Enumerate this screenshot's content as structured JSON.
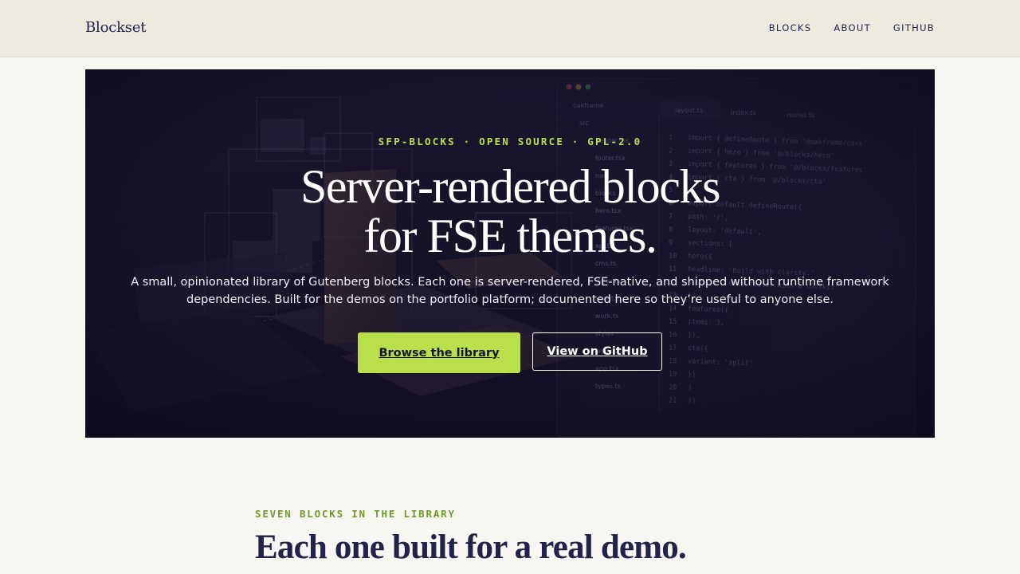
{
  "header": {
    "logo": "Blockset",
    "nav": [
      {
        "label": "BLOCKS"
      },
      {
        "label": "ABOUT"
      },
      {
        "label": "GITHUB"
      }
    ]
  },
  "hero": {
    "eyebrow": "SFP-BLOCKS · OPEN SOURCE · GPL-2.0",
    "title_line1": "Server-rendered blocks",
    "title_line2": "for FSE themes.",
    "description": "A small, opinionated library of Gutenberg blocks. Each one is server-rendered, FSE-native, and shipped without runtime framework dependencies. Built for the demos on the portfolio platform; documented here so they’re useful to anyone else.",
    "primary_button": "Browse the library",
    "secondary_button": "View on GitHub",
    "editor": {
      "tree": [
        "oakframe",
        "src",
        "header.tsx",
        "footer.tsx",
        "nav",
        "blocks",
        "hero.tsx",
        "features.tsx",
        "api.ts",
        "cms.ts",
        "index.ts",
        "about.ts",
        "work.ts",
        "styles",
        "layout.tsx",
        "app.tsx",
        "types.ts"
      ],
      "tabs": [
        "layout.ts",
        "index.ts",
        "routes.ts"
      ],
      "code": [
        "import { defineRoute } from '@oakframe/core'",
        "import { hero } from '@/blocks/hero'",
        "import { features } from '@/blocks/features'",
        "import { cta } from '@/blocks/cta'",
        "",
        "export default defineRoute({",
        "  path: '/',",
        "  layout: 'default',",
        "  sections: [",
        "    hero({",
        "      headline: 'Build with clarity.'",
        "      subhead: 'Ship faster with a toolkit'",
        "    }),",
        "    features({",
        "      items: 3,",
        "    }),",
        "    cta({",
        "      variant: 'split'",
        "    })",
        "  ]",
        "})"
      ]
    }
  },
  "section": {
    "eyebrow": "SEVEN BLOCKS IN THE LIBRARY",
    "title": "Each one built for a real demo."
  },
  "colors": {
    "accent": "#b9e04a",
    "hero_bg": "#16122a",
    "header_bg": "#edeae0",
    "page_bg": "#f8f6f1",
    "ink": "#23224a"
  }
}
